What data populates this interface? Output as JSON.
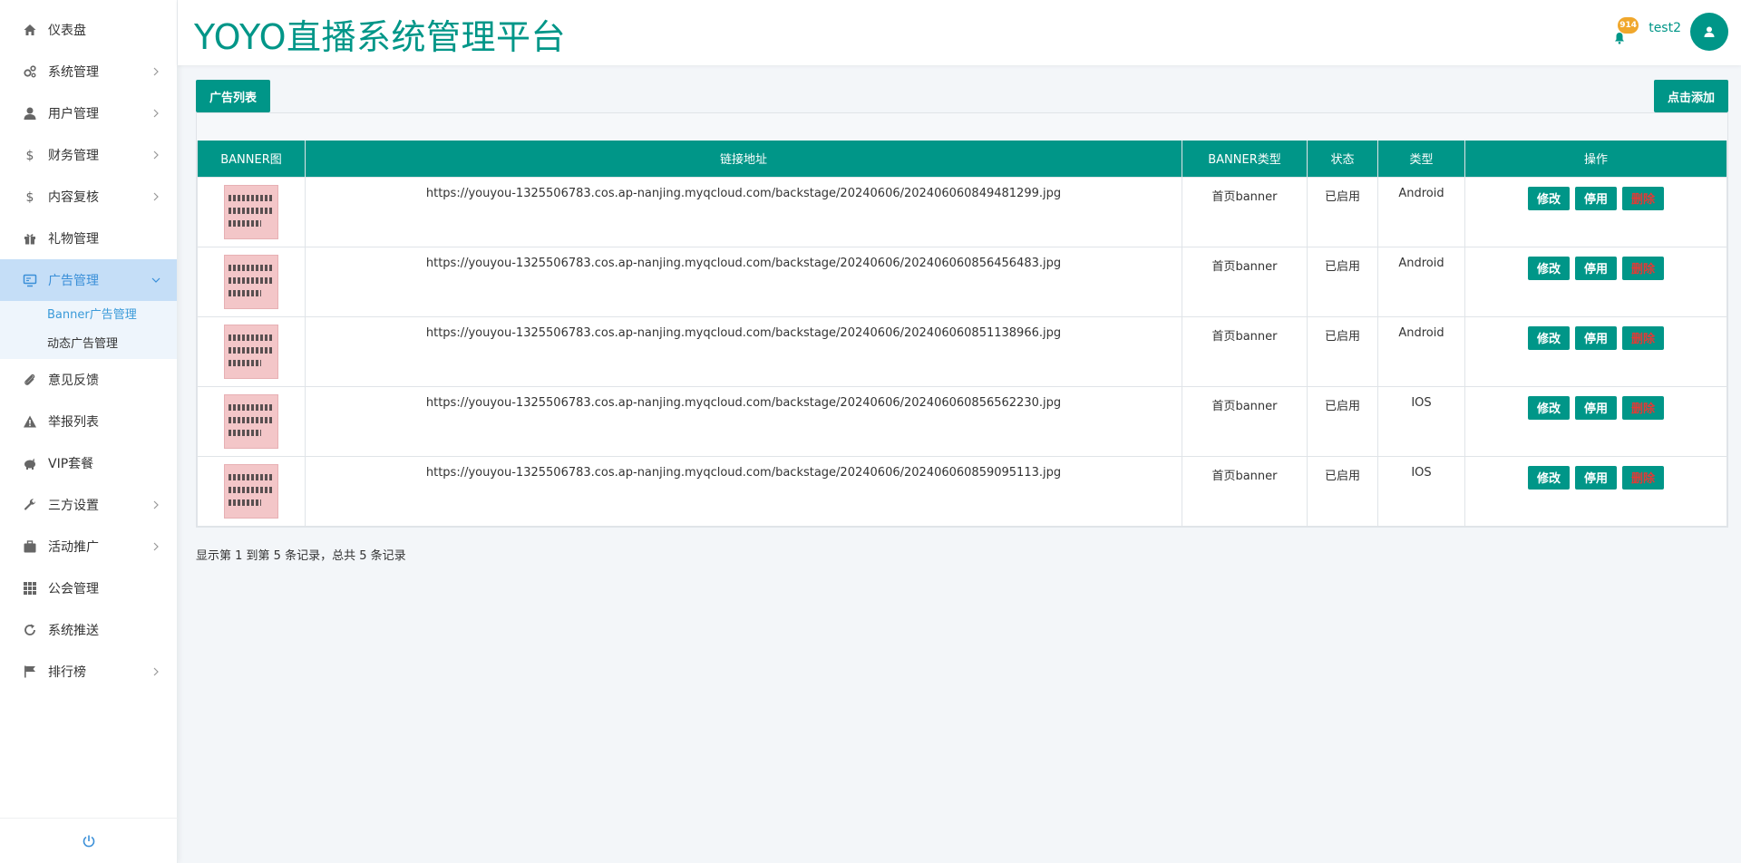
{
  "app": {
    "title": "YOYO直播系统管理平台"
  },
  "colors": {
    "accent": "#009688",
    "active_bg": "#c5def7",
    "active_text": "#3a8fd8",
    "danger_text": "#e53935"
  },
  "header": {
    "notification_count": "914",
    "username": "test2"
  },
  "sidebar": {
    "items": [
      {
        "label": "仪表盘",
        "icon": "home-icon",
        "has_children": false
      },
      {
        "label": "系统管理",
        "icon": "cogs-icon",
        "has_children": true
      },
      {
        "label": "用户管理",
        "icon": "user-icon",
        "has_children": true
      },
      {
        "label": "财务管理",
        "icon": "dollar-icon",
        "has_children": true
      },
      {
        "label": "内容复核",
        "icon": "dollar-icon",
        "has_children": true
      },
      {
        "label": "礼物管理",
        "icon": "gift-icon",
        "has_children": false
      },
      {
        "label": "广告管理",
        "icon": "monitor-icon",
        "has_children": true,
        "expanded": true,
        "children": [
          {
            "label": "Banner广告管理",
            "current": true
          },
          {
            "label": "动态广告管理",
            "current": false
          }
        ]
      },
      {
        "label": "意见反馈",
        "icon": "paperclip-icon",
        "has_children": false
      },
      {
        "label": "举报列表",
        "icon": "warning-icon",
        "has_children": false
      },
      {
        "label": "VIP套餐",
        "icon": "piggy-bank-icon",
        "has_children": false
      },
      {
        "label": "三方设置",
        "icon": "wrench-icon",
        "has_children": true
      },
      {
        "label": "活动推广",
        "icon": "briefcase-icon",
        "has_children": true
      },
      {
        "label": "公会管理",
        "icon": "grid-icon",
        "has_children": false
      },
      {
        "label": "系统推送",
        "icon": "refresh-icon",
        "has_children": false
      },
      {
        "label": "排行榜",
        "icon": "flag-icon",
        "has_children": true
      }
    ]
  },
  "main": {
    "list_button": "广告列表",
    "add_button": "点击添加",
    "table": {
      "columns": [
        "BANNER图",
        "链接地址",
        "BANNER类型",
        "状态",
        "类型",
        "操作"
      ],
      "rows": [
        {
          "url": "https://youyou-1325506783.cos.ap-nanjing.myqcloud.com/backstage/20240606/202406060849481299.jpg",
          "banner_type": "首页banner",
          "status": "已启用",
          "type": "Android"
        },
        {
          "url": "https://youyou-1325506783.cos.ap-nanjing.myqcloud.com/backstage/20240606/202406060856456483.jpg",
          "banner_type": "首页banner",
          "status": "已启用",
          "type": "Android"
        },
        {
          "url": "https://youyou-1325506783.cos.ap-nanjing.myqcloud.com/backstage/20240606/202406060851138966.jpg",
          "banner_type": "首页banner",
          "status": "已启用",
          "type": "Android"
        },
        {
          "url": "https://youyou-1325506783.cos.ap-nanjing.myqcloud.com/backstage/20240606/202406060856562230.jpg",
          "banner_type": "首页banner",
          "status": "已启用",
          "type": "IOS"
        },
        {
          "url": "https://youyou-1325506783.cos.ap-nanjing.myqcloud.com/backstage/20240606/202406060859095113.jpg",
          "banner_type": "首页banner",
          "status": "已启用",
          "type": "IOS"
        }
      ],
      "actions": {
        "edit": "修改",
        "disable": "停用",
        "delete": "删除"
      }
    },
    "pager_info": "显示第 1 到第 5 条记录，总共 5 条记录"
  }
}
